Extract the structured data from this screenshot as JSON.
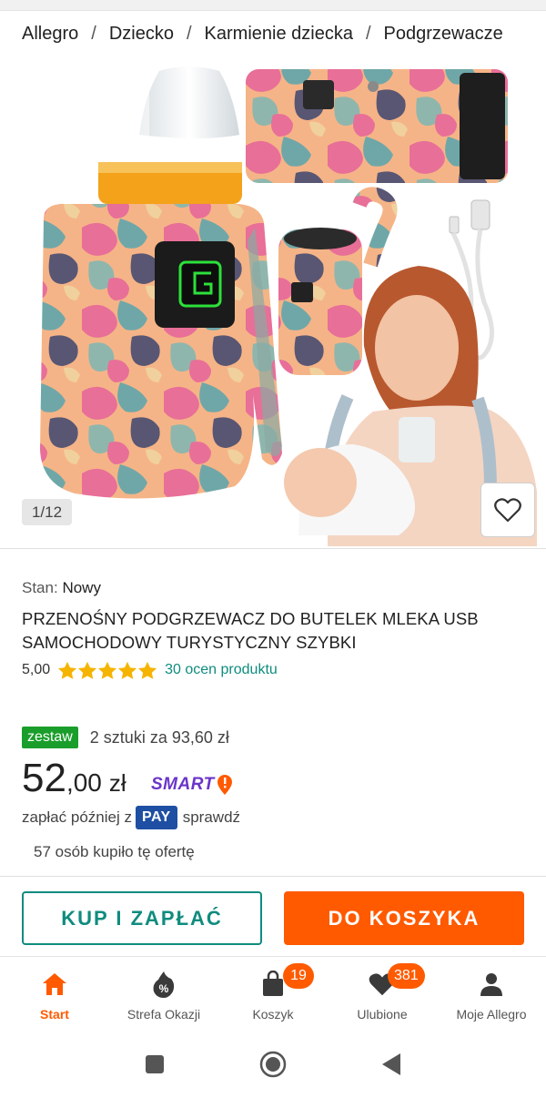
{
  "breadcrumb": [
    "Allegro",
    "Dziecko",
    "Karmienie dziecka",
    "Podgrzewacze"
  ],
  "gallery": {
    "counter": "1/12"
  },
  "product": {
    "condition_label": "Stan:",
    "condition_value": "Nowy",
    "title": "PRZENOŚNY PODGRZEWACZ DO BUTELEK MLEKA USB SAMOCHODOWY TURYSTYCZNY SZYBKI",
    "rating_score": "5,00",
    "rating_stars": 5,
    "rating_count": "30 ocen produktu"
  },
  "offer": {
    "set_badge": "zestaw",
    "set_text": "2 sztuki za 93,60 zł",
    "price_int": "52",
    "price_dec": ",00",
    "price_currency": "zł",
    "smart_label": "SMART",
    "paylater_prefix": "zapłać później z",
    "pay_badge": "PAY",
    "paylater_link": "sprawdź",
    "bought": "57 osób kupiło tę ofertę"
  },
  "actions": {
    "buy_now": "KUP I ZAPŁAĆ",
    "add_to_cart": "DO KOSZYKA"
  },
  "bottom_nav": {
    "items": [
      {
        "label": "Start",
        "icon": "home-icon",
        "active": true
      },
      {
        "label": "Strefa Okazji",
        "icon": "discount-icon"
      },
      {
        "label": "Koszyk",
        "icon": "bag-icon",
        "badge": "19"
      },
      {
        "label": "Ulubione",
        "icon": "heart-icon",
        "badge": "381"
      },
      {
        "label": "Moje Allegro",
        "icon": "user-icon"
      }
    ]
  },
  "colors": {
    "accent": "#ff5a00",
    "teal": "#0f8c7e",
    "set_green": "#1a9e2b",
    "smart_purple": "#6a35c9",
    "pay_blue": "#1e4fa3"
  }
}
